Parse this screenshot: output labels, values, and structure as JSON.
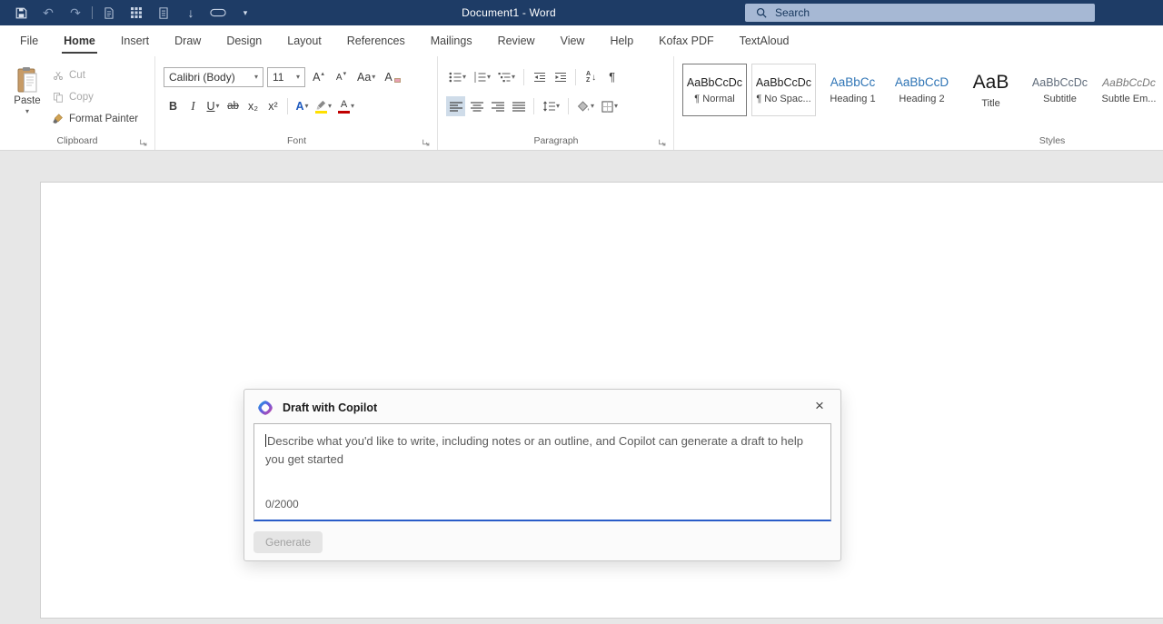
{
  "titlebar": {
    "title": "Document1 - Word",
    "search_label": "Search"
  },
  "tabs": [
    {
      "label": "File"
    },
    {
      "label": "Home"
    },
    {
      "label": "Insert"
    },
    {
      "label": "Draw"
    },
    {
      "label": "Design"
    },
    {
      "label": "Layout"
    },
    {
      "label": "References"
    },
    {
      "label": "Mailings"
    },
    {
      "label": "Review"
    },
    {
      "label": "View"
    },
    {
      "label": "Help"
    },
    {
      "label": "Kofax PDF"
    },
    {
      "label": "TextAloud"
    }
  ],
  "ribbon": {
    "clipboard": {
      "label": "Clipboard",
      "paste": "Paste",
      "cut": "Cut",
      "copy": "Copy",
      "format_painter": "Format Painter"
    },
    "font": {
      "label": "Font",
      "name": "Calibri (Body)",
      "size": "11"
    },
    "paragraph": {
      "label": "Paragraph"
    },
    "styles": {
      "label": "Styles",
      "items": [
        {
          "preview": "AaBbCcDc",
          "name": "¶ Normal"
        },
        {
          "preview": "AaBbCcDc",
          "name": "¶ No Spac..."
        },
        {
          "preview": "AaBbCc",
          "name": "Heading 1"
        },
        {
          "preview": "AaBbCcD",
          "name": "Heading 2"
        },
        {
          "preview": "AaB",
          "name": "Title"
        },
        {
          "preview": "AaBbCcDc",
          "name": "Subtitle"
        },
        {
          "preview": "AaBbCcDc",
          "name": "Subtle Em..."
        }
      ]
    }
  },
  "glyphs": {
    "chevron_down": "▾",
    "arrow_up_small": "▴",
    "arrow_down_small": "▾",
    "undo": "↶",
    "redo": "↷",
    "arrow_down": "↓",
    "bold": "B",
    "italic": "I",
    "underline": "U",
    "strikethrough": "ab",
    "subscript": "x₂",
    "superscript": "x²",
    "grow_font": "A",
    "shrink_font": "A",
    "change_case": "Aa",
    "clear_format": "A",
    "text_effects": "A",
    "font_color": "A",
    "pilcrow": "¶",
    "sort_a": "A",
    "sort_z": "Z",
    "close": "×"
  },
  "dialog": {
    "title": "Draft with Copilot",
    "placeholder": "Describe what you'd like to write, including notes or an outline, and Copilot can generate a draft to help you get started",
    "counter": "0/2000",
    "generate": "Generate"
  },
  "colors": {
    "titlebar": "#1e3c66",
    "accent": "#2a5cc8",
    "heading_blue": "#2e74b5"
  }
}
